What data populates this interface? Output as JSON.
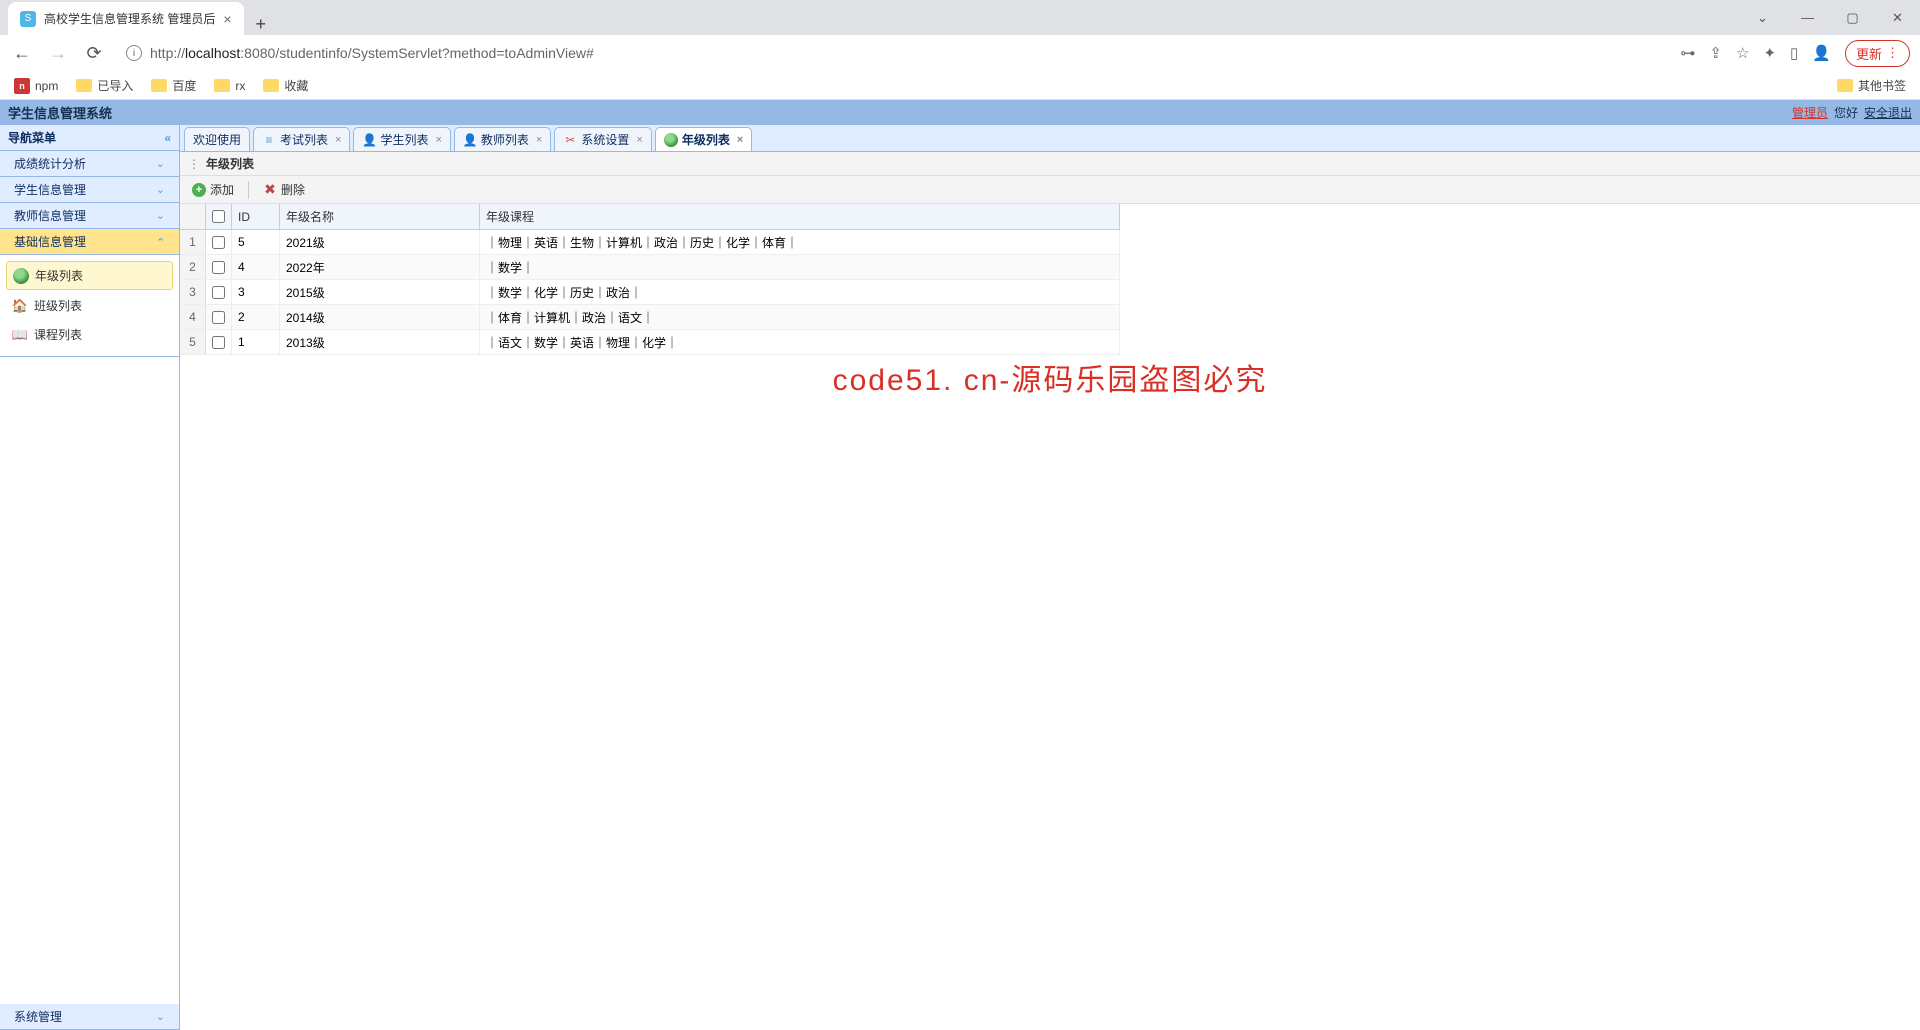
{
  "browser": {
    "tab_title": "高校学生信息管理系统 管理员后",
    "url_prefix": "http://",
    "url_host": "localhost",
    "url_path": ":8080/studentinfo/SystemServlet?method=toAdminView#",
    "update_label": "更新",
    "bookmarks": {
      "npm": "npm",
      "imported": "已导入",
      "baidu": "百度",
      "rx": "rx",
      "fav": "收藏",
      "other": "其他书签"
    }
  },
  "app": {
    "title": "学生信息管理系统",
    "admin_label": "管理员",
    "greeting": "您好",
    "logout": "安全退出"
  },
  "sidebar": {
    "header": "导航菜单",
    "items": [
      {
        "label": "成绩统计分析"
      },
      {
        "label": "学生信息管理"
      },
      {
        "label": "教师信息管理"
      },
      {
        "label": "基础信息管理"
      }
    ],
    "sub": [
      {
        "label": "年级列表"
      },
      {
        "label": "班级列表"
      },
      {
        "label": "课程列表"
      }
    ],
    "footer": "系统管理"
  },
  "tabs": [
    {
      "label": "欢迎使用",
      "closable": false
    },
    {
      "label": "考试列表",
      "closable": true
    },
    {
      "label": "学生列表",
      "closable": true
    },
    {
      "label": "教师列表",
      "closable": true
    },
    {
      "label": "系统设置",
      "closable": true
    },
    {
      "label": "年级列表",
      "closable": true
    }
  ],
  "panel": {
    "title": "年级列表"
  },
  "toolbar": {
    "add": "添加",
    "del": "删除"
  },
  "table": {
    "headers": {
      "id": "ID",
      "name": "年级名称",
      "course": "年级课程"
    },
    "rows": [
      {
        "num": "1",
        "id": "5",
        "name": "2021级",
        "course": "｜物理｜英语｜生物｜计算机｜政治｜历史｜化学｜体育｜"
      },
      {
        "num": "2",
        "id": "4",
        "name": "2022年",
        "course": "｜数学｜"
      },
      {
        "num": "3",
        "id": "3",
        "name": "2015级",
        "course": "｜数学｜化学｜历史｜政治｜"
      },
      {
        "num": "4",
        "id": "2",
        "name": "2014级",
        "course": "｜体育｜计算机｜政治｜语文｜"
      },
      {
        "num": "5",
        "id": "1",
        "name": "2013级",
        "course": "｜语文｜数学｜英语｜物理｜化学｜"
      }
    ]
  },
  "watermark": "code51. cn-源码乐园盗图必究"
}
